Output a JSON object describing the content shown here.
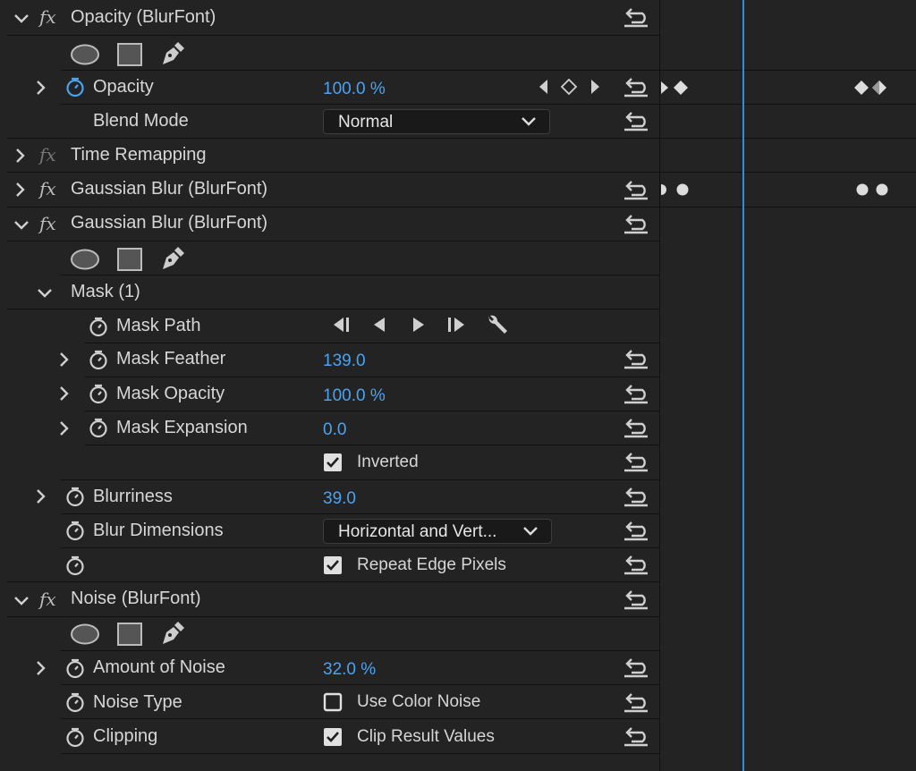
{
  "effects": {
    "opacity": {
      "title": "Opacity (BlurFont)",
      "property_label": "Opacity",
      "property_value": "100.0 %",
      "blend_mode_label": "Blend Mode",
      "blend_mode_value": "Normal"
    },
    "time_remapping": {
      "title": "Time Remapping"
    },
    "gaussian_blur_1": {
      "title": "Gaussian Blur (BlurFont)"
    },
    "gaussian_blur_2": {
      "title": "Gaussian Blur (BlurFont)",
      "mask": {
        "title": "Mask (1)",
        "path_label": "Mask Path",
        "feather_label": "Mask Feather",
        "feather_value": "139.0",
        "opacity_label": "Mask Opacity",
        "opacity_value": "100.0 %",
        "expansion_label": "Mask Expansion",
        "expansion_value": "0.0",
        "inverted_label": "Inverted",
        "inverted_checked": true
      },
      "blurriness_label": "Blurriness",
      "blurriness_value": "39.0",
      "dimensions_label": "Blur Dimensions",
      "dimensions_value": "Horizontal and Vert...",
      "repeat_edge_label": "Repeat Edge Pixels",
      "repeat_edge_checked": true
    },
    "noise": {
      "title": "Noise (BlurFont)",
      "amount_label": "Amount of Noise",
      "amount_value": "32.0 %",
      "type_label": "Noise Type",
      "color_noise_label": "Use Color Noise",
      "color_noise_checked": false,
      "clipping_label": "Clipping",
      "clip_result_label": "Clip Result Values",
      "clip_result_checked": true
    }
  },
  "fx_glyph": "fx",
  "colors": {
    "accent_value": "#4aa3f2",
    "playhead": "#2f8de0",
    "background": "#232323"
  }
}
